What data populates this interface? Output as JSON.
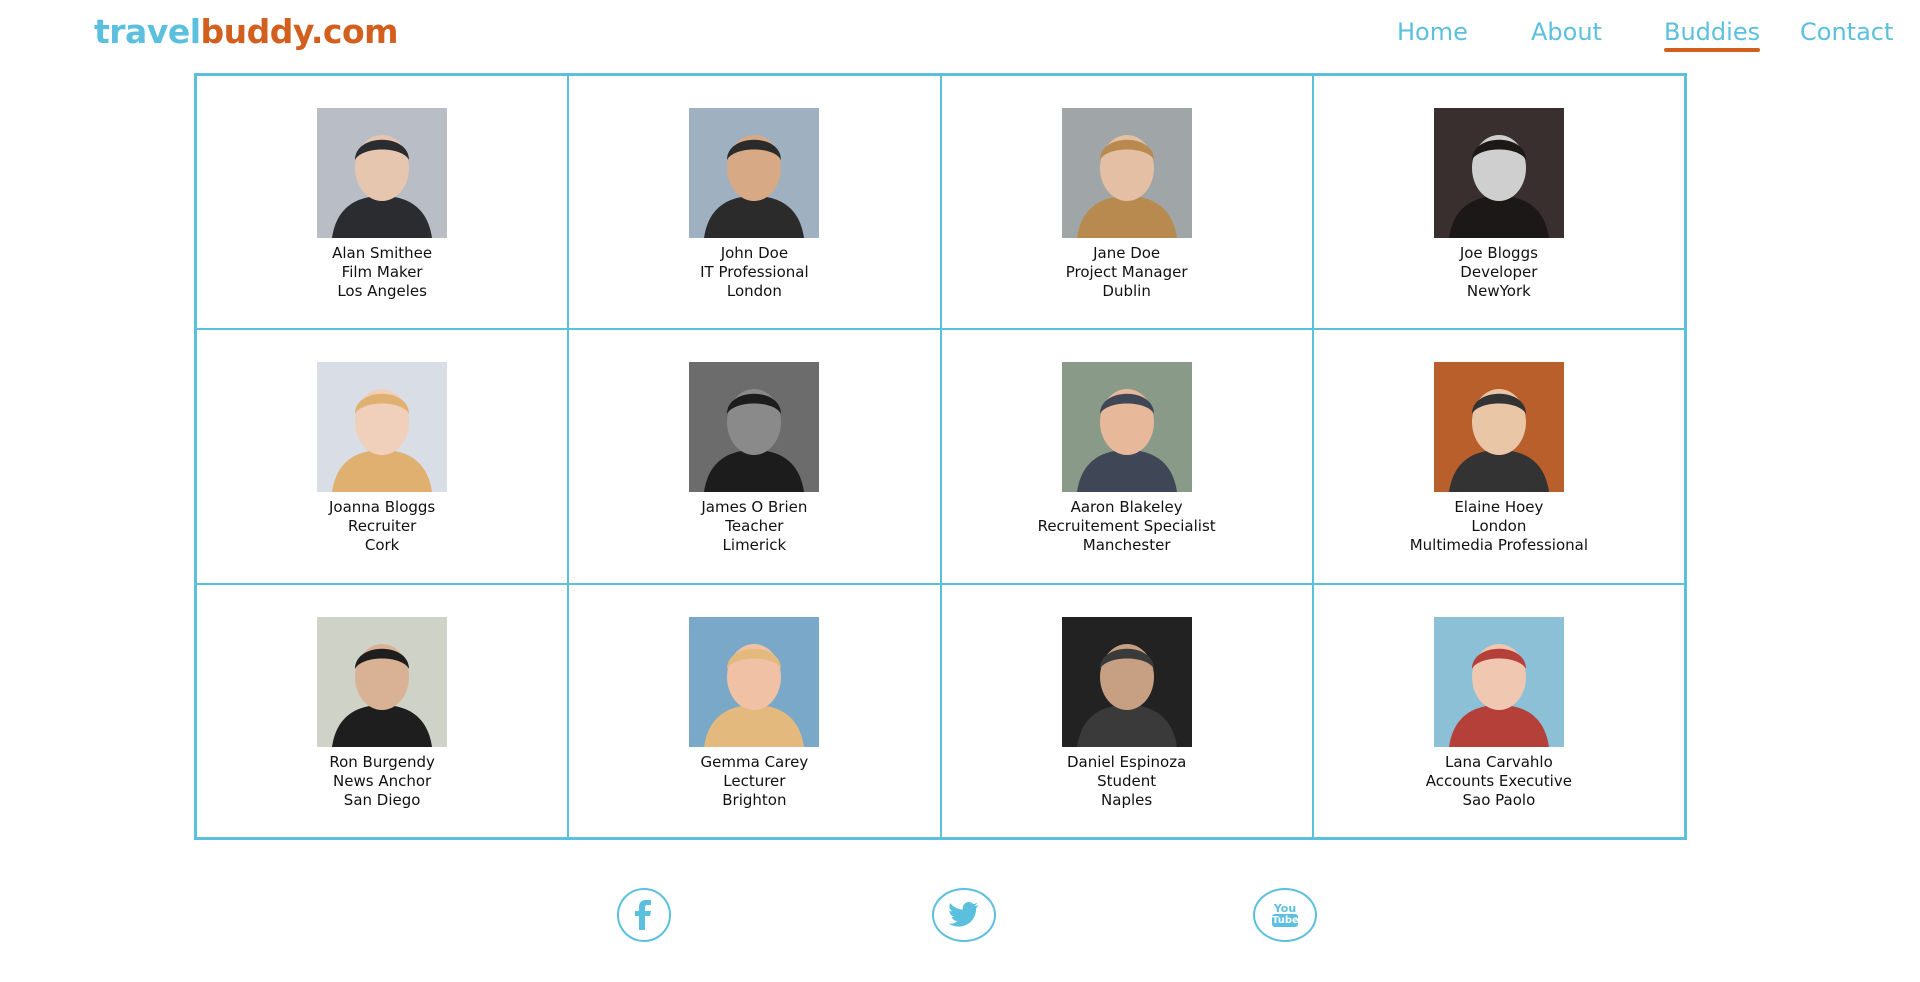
{
  "header": {
    "logo_part1": "travel",
    "logo_part2": "buddy.com",
    "nav": [
      "Home",
      "About",
      "Buddies",
      "Contact"
    ],
    "active": "Buddies"
  },
  "colors": {
    "accent": "#5bc0de",
    "brand": "#d35f1e"
  },
  "buddies": [
    {
      "name": "Alan Smithee",
      "line2": "Film Maker",
      "line3": "Los Angeles"
    },
    {
      "name": "John Doe",
      "line2": "IT Professional",
      "line3": "London"
    },
    {
      "name": "Jane Doe",
      "line2": "Project Manager",
      "line3": "Dublin"
    },
    {
      "name": "Joe Bloggs",
      "line2": "Developer",
      "line3": "NewYork"
    },
    {
      "name": "Joanna Bloggs",
      "line2": "Recruiter",
      "line3": "Cork"
    },
    {
      "name": "James O Brien",
      "line2": "Teacher",
      "line3": "Limerick"
    },
    {
      "name": "Aaron Blakeley",
      "line2": "Recruitement Specialist",
      "line3": "Manchester"
    },
    {
      "name": "Elaine Hoey",
      "line2": "London",
      "line3": "Multimedia Professional"
    },
    {
      "name": "Ron Burgendy",
      "line2": "News Anchor",
      "line3": "San Diego"
    },
    {
      "name": "Gemma Carey",
      "line2": "Lecturer",
      "line3": "Brighton"
    },
    {
      "name": "Daniel Espinoza",
      "line2": "Student",
      "line3": "Naples"
    },
    {
      "name": "Lana Carvahlo",
      "line2": "Accounts Executive",
      "line3": "Sao Paolo"
    }
  ],
  "social": [
    {
      "icon": "facebook-icon"
    },
    {
      "icon": "twitter-icon"
    },
    {
      "icon": "youtube-icon",
      "text": "You Tube"
    }
  ]
}
